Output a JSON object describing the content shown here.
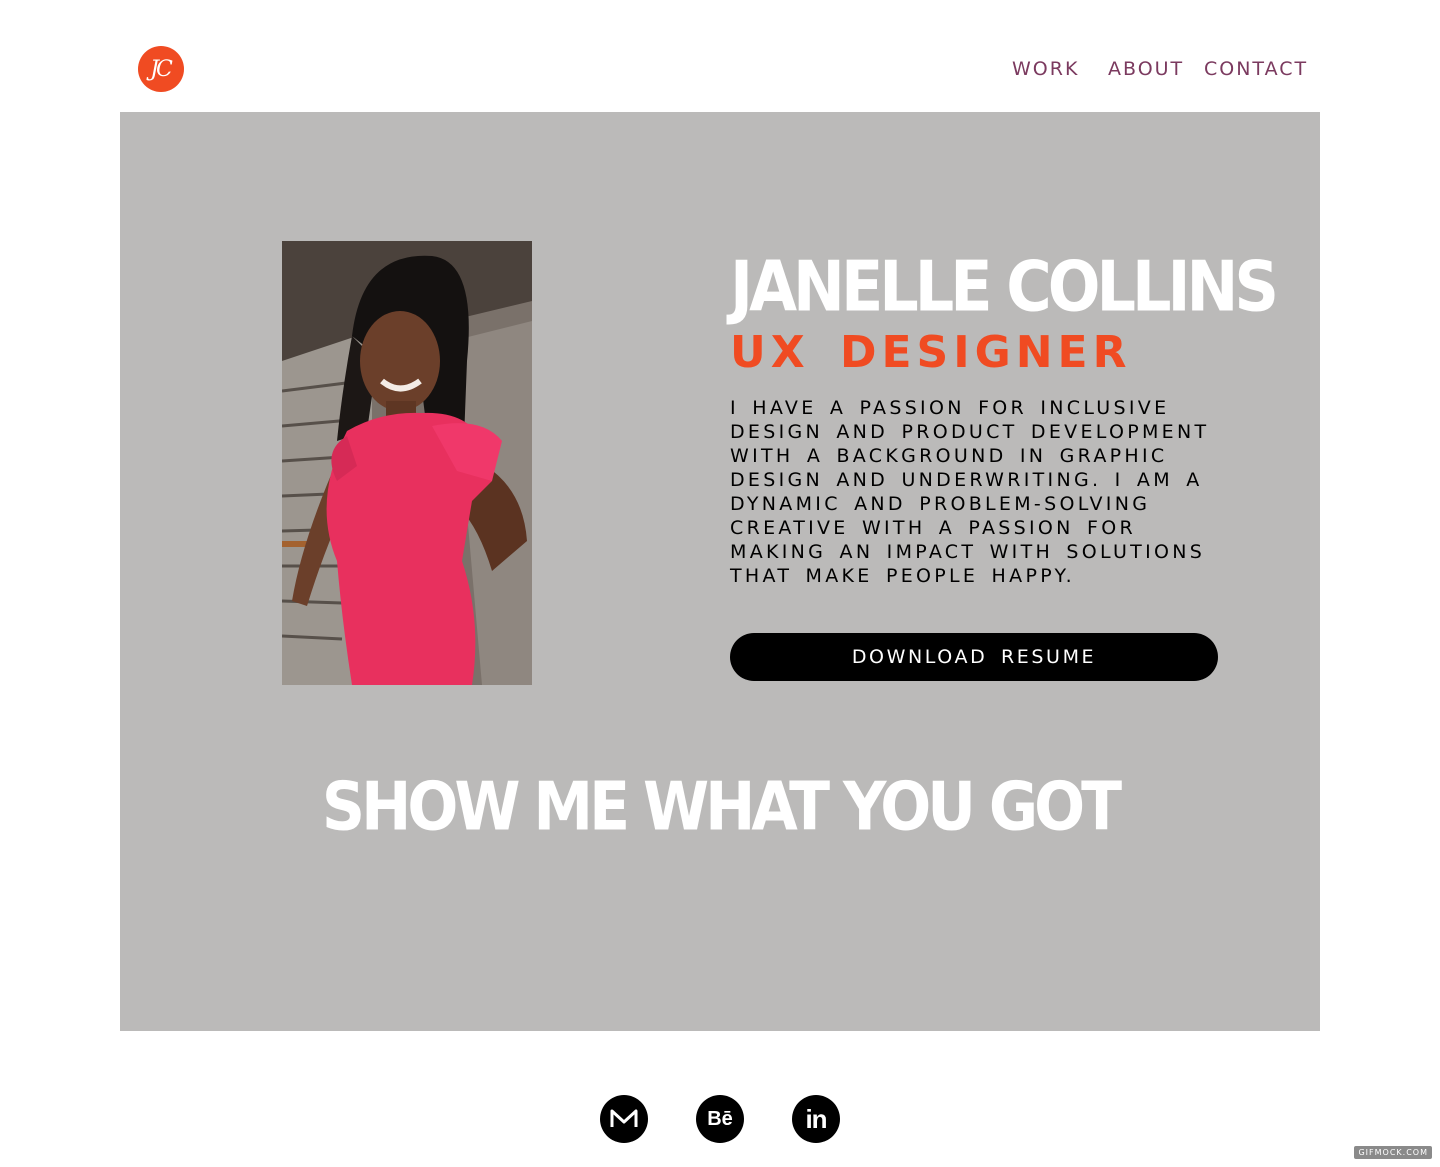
{
  "header": {
    "logo_text": "JC",
    "nav": {
      "work": "WORK",
      "about": "ABOUT",
      "contact": "CONTACT"
    }
  },
  "hero": {
    "name": "JANELLE COLLINS",
    "role": "UX DESIGNER",
    "bio": "I HAVE A PASSION FOR INCLUSIVE DESIGN AND PRODUCT DEVELOPMENT WITH A BACKGROUND IN GRAPHIC DESIGN AND UNDERWRITING. I AM A DYNAMIC AND PROBLEM-SOLVING CREATIVE WITH A PASSION FOR MAKING AN IMPACT WITH SOLUTIONS THAT MAKE PEOPLE HAPPY.",
    "resume_button": "DOWNLOAD RESUME",
    "tagline": "SHOW ME WHAT YOU GOT"
  },
  "social": {
    "medium_letter": "M",
    "behance_letters": "Bē",
    "linkedin_letters": "in"
  },
  "watermark": "GIFMOCK.COM",
  "colors": {
    "accent": "#f04b22",
    "nav": "#7b3a5f",
    "hero_bg": "#bbbab9",
    "dress": "#e8305e"
  },
  "icons": [
    "medium-icon",
    "behance-icon",
    "linkedin-icon"
  ]
}
